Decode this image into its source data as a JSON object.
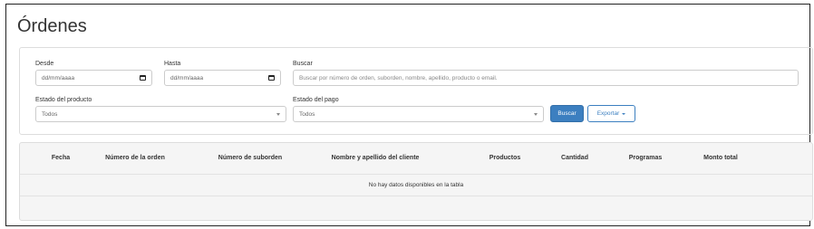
{
  "page": {
    "title": "Órdenes"
  },
  "filters": {
    "desde_label": "Desde",
    "desde_value": "dd/mm/aaaa",
    "hasta_label": "Hasta",
    "hasta_value": "dd/mm/aaaa",
    "buscar_label": "Buscar",
    "buscar_placeholder": "Buscar por número de orden, suborden, nombre, apellido, producto o email.",
    "estado_producto_label": "Estado del producto",
    "estado_producto_value": "Todos",
    "estado_pago_label": "Estado del pago",
    "estado_pago_value": "Todos",
    "buscar_button": "Buscar",
    "exportar_button": "Exportar"
  },
  "table": {
    "columns": [
      "Fecha",
      "Número de la orden",
      "Número de suborden",
      "Nombre y apellido del cliente",
      "Productos",
      "Cantidad",
      "Programas",
      "Monto total"
    ],
    "empty_message": "No hay datos disponibles en la tabla"
  },
  "colors": {
    "primary": "#3c7fc0",
    "border": "#dddddd",
    "table_bg": "#f5f5f5"
  },
  "icons": {
    "date": "calendar-icon",
    "select": "chevron-down-icon"
  }
}
